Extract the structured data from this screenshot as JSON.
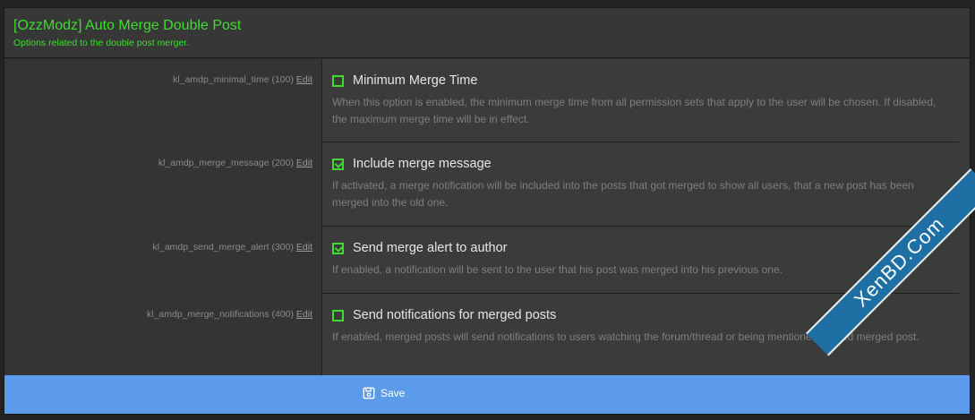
{
  "header": {
    "title": "[OzzModz] Auto Merge Double Post",
    "subtitle": "Options related to the double post merger."
  },
  "options": [
    {
      "key": "kl_amdp_minimal_time (100)",
      "edit_label": "Edit",
      "label": "Minimum Merge Time",
      "checked": false,
      "description": "When this option is enabled, the minimum merge time from all permission sets that apply to the user will be chosen. If disabled, the maximum merge time will be in effect."
    },
    {
      "key": "kl_amdp_merge_message (200)",
      "edit_label": "Edit",
      "label": "Include merge message",
      "checked": true,
      "description": "If activated, a merge notification will be included into the posts that got merged to show all users, that a new post has been merged into the old one."
    },
    {
      "key": "kl_amdp_send_merge_alert (300)",
      "edit_label": "Edit",
      "label": "Send merge alert to author",
      "checked": true,
      "description": "If enabled, a notification will be sent to the user that his post was merged into his previous one."
    },
    {
      "key": "kl_amdp_merge_notifications (400)",
      "edit_label": "Edit",
      "label": "Send notifications for merged posts",
      "checked": false,
      "description": "If enabled, merged posts will send notifications to users watching the forum/thread or being mentioned/quoted merged post."
    }
  ],
  "footer": {
    "save_label": "Save",
    "save_icon": "floppy-disk-icon"
  },
  "watermark": {
    "text": "XenBD.Com"
  },
  "colors": {
    "accent": "#3fdc30",
    "save_bar": "#5b9bea",
    "ribbon": "#1e6fa3"
  }
}
